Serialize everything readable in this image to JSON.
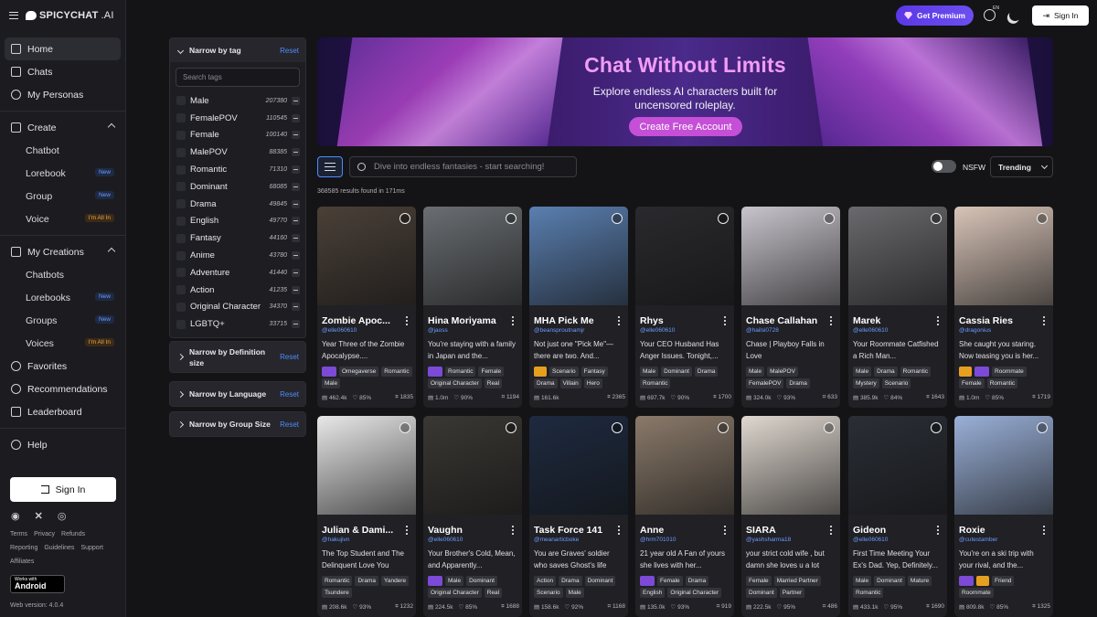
{
  "brand": {
    "name": "SPICYCHAT",
    "suffix": ".AI"
  },
  "sidebar": {
    "main": [
      {
        "label": "Home",
        "icon": "home-icon",
        "active": true
      },
      {
        "label": "Chats",
        "icon": "chat-icon"
      },
      {
        "label": "My Personas",
        "icon": "mask-icon"
      }
    ],
    "create": {
      "label": "Create",
      "icon": "plus-square-icon",
      "items": [
        {
          "label": "Chatbot",
          "badge": ""
        },
        {
          "label": "Lorebook",
          "badge": "New"
        },
        {
          "label": "Group",
          "badge": "New"
        },
        {
          "label": "Voice",
          "badge": "I'm All In"
        }
      ]
    },
    "creations": {
      "label": "My Creations",
      "icon": "folder-icon",
      "items": [
        {
          "label": "Chatbots",
          "badge": ""
        },
        {
          "label": "Lorebooks",
          "badge": "New"
        },
        {
          "label": "Groups",
          "badge": "New"
        },
        {
          "label": "Voices",
          "badge": "I'm All In"
        }
      ]
    },
    "extra": [
      {
        "label": "Favorites",
        "icon": "heart-icon"
      },
      {
        "label": "Recommendations",
        "icon": "compass-icon"
      },
      {
        "label": "Leaderboard",
        "icon": "trophy-icon"
      }
    ],
    "help": "Help",
    "signin": "Sign In",
    "links1": [
      "Terms",
      "Privacy",
      "Refunds"
    ],
    "links2": [
      "Reporting",
      "Guidelines",
      "Support"
    ],
    "links3": [
      "Affiliates"
    ],
    "android_small": "Works with",
    "android": "Android",
    "version": "Web version: 4.0.4"
  },
  "topbar": {
    "premium": "Get Premium",
    "lang": "EN",
    "signin": "Sign In"
  },
  "filters": {
    "tag_title": "Narrow by tag",
    "reset": "Reset",
    "search_placeholder": "Search tags",
    "tags": [
      {
        "label": "Male",
        "count": "207380"
      },
      {
        "label": "FemalePOV",
        "count": "110545"
      },
      {
        "label": "Female",
        "count": "100140"
      },
      {
        "label": "MalePOV",
        "count": "88385"
      },
      {
        "label": "Romantic",
        "count": "71310"
      },
      {
        "label": "Dominant",
        "count": "68085"
      },
      {
        "label": "Drama",
        "count": "49845"
      },
      {
        "label": "English",
        "count": "49770"
      },
      {
        "label": "Fantasy",
        "count": "44160"
      },
      {
        "label": "Anime",
        "count": "43780"
      },
      {
        "label": "Adventure",
        "count": "41440"
      },
      {
        "label": "Action",
        "count": "41235"
      },
      {
        "label": "Original Character",
        "count": "34370"
      },
      {
        "label": "LGBTQ+",
        "count": "33715"
      }
    ],
    "definition_title": "Narrow by Definition size",
    "language_title": "Narrow by Language",
    "group_title": "Narrow by Group Size"
  },
  "banner": {
    "title": "Chat Without Limits",
    "subtitle": "Explore endless AI characters built for uncensored roleplay.",
    "cta": "Create Free Account"
  },
  "search": {
    "placeholder": "Dive into endless fantasies - start searching!",
    "results": "368585 results found in 171ms",
    "nsfw": "NSFW",
    "sort": "Trending"
  },
  "cards": [
    {
      "name": "Zombie Apoc...",
      "handle": "@elle060610",
      "desc": "Year Three of the Zombie Apocalypse....",
      "tags": [
        "#purple",
        "Omegaverse",
        "Romantic",
        "Male"
      ],
      "chats": "462.4k",
      "rating": "85%",
      "count": "1835",
      "bg": "#4a4038"
    },
    {
      "name": "Hina Moriyama",
      "handle": "@jaoss",
      "desc": "You're staying with a family in Japan and the...",
      "tags": [
        "#purple",
        "Romantic",
        "Female",
        "Original Character",
        "Real"
      ],
      "chats": "1.0m",
      "rating": "90%",
      "count": "1194",
      "bg": "#6a6e72"
    },
    {
      "name": "MHA Pick Me",
      "handle": "@beansproutnamjr",
      "desc": "Not just one \"Pick Me\"— there are two. And...",
      "tags": [
        "#yellow",
        "Scenario",
        "Fantasy",
        "Drama",
        "Villain",
        "Hero"
      ],
      "chats": "161.6k",
      "rating": "",
      "count": "2365",
      "bg": "#5a7fb0"
    },
    {
      "name": "Rhys",
      "handle": "@elle060610",
      "desc": "Your CEO Husband Has Anger Issues. Tonight,...",
      "tags": [
        "Male",
        "Dominant",
        "Drama",
        "Romantic"
      ],
      "chats": "697.7k",
      "rating": "90%",
      "count": "1700",
      "bg": "#2a2a2e"
    },
    {
      "name": "Chase Callahan",
      "handle": "@hailsi0728",
      "desc": "Chase | Playboy Falls in Love",
      "tags": [
        "Male",
        "MalePOV",
        "FemalePOV",
        "Drama"
      ],
      "chats": "324.0k",
      "rating": "93%",
      "count": "633",
      "bg": "#c8c4cc"
    },
    {
      "name": "Marek",
      "handle": "@elle060610",
      "desc": "Your Roommate Catfished a Rich Man...",
      "tags": [
        "Male",
        "Drama",
        "Romantic",
        "Mystery",
        "Scenario"
      ],
      "chats": "385.9k",
      "rating": "84%",
      "count": "1643",
      "bg": "#6a6a6e"
    },
    {
      "name": "Cassia Ries",
      "handle": "@dragonius",
      "desc": "She caught you staring. Now teasing you is her...",
      "tags": [
        "#yellow",
        "#purple",
        "Roommate",
        "Female",
        "Romantic"
      ],
      "chats": "1.0m",
      "rating": "85%",
      "count": "1719",
      "bg": "#d8c4b8"
    },
    {
      "name": "Julian & Dami...",
      "handle": "@hakujivn",
      "desc": "The Top Student and The Delinquent Love You",
      "tags": [
        "Romantic",
        "Drama",
        "Yandere",
        "Tsundere"
      ],
      "chats": "208.6k",
      "rating": "93%",
      "count": "1232",
      "bg": "#e8e8e8"
    },
    {
      "name": "Vaughn",
      "handle": "@elle060610",
      "desc": "Your Brother's Cold, Mean, and Apparently...",
      "tags": [
        "#purple",
        "Male",
        "Dominant",
        "Original Character",
        "Real"
      ],
      "chats": "224.5k",
      "rating": "85%",
      "count": "1688",
      "bg": "#3a3834"
    },
    {
      "name": "Task Force 141",
      "handle": "@meanarticboke",
      "desc": "You are Graves' soldier who saves Ghost's life",
      "tags": [
        "Action",
        "Drama",
        "Dominant",
        "Scenario",
        "Male"
      ],
      "chats": "158.6k",
      "rating": "92%",
      "count": "1168",
      "bg": "#1e2a40"
    },
    {
      "name": "Anne",
      "handle": "@hrm701010",
      "desc": "21 year old A Fan of yours she lives with her...",
      "tags": [
        "#purple",
        "Female",
        "Drama",
        "English",
        "Original Character"
      ],
      "chats": "135.0k",
      "rating": "93%",
      "count": "919",
      "bg": "#8a7a6a"
    },
    {
      "name": "SIARA",
      "handle": "@yashsharma18",
      "desc": "your strict cold wife , but damn she loves u a lot",
      "tags": [
        "Female",
        "Married Partner",
        "Dominant",
        "Partner"
      ],
      "chats": "222.5k",
      "rating": "95%",
      "count": "486",
      "bg": "#e0d8d0"
    },
    {
      "name": "Gideon",
      "handle": "@elle060610",
      "desc": "First Time Meeting Your Ex's Dad. Yep, Definitely...",
      "tags": [
        "Male",
        "Dominant",
        "Mature",
        "Romantic"
      ],
      "chats": "433.1k",
      "rating": "95%",
      "count": "1690",
      "bg": "#2a2e36"
    },
    {
      "name": "Roxie",
      "handle": "@cutestamber",
      "desc": "You're on a ski trip with your rival, and the...",
      "tags": [
        "#purple",
        "#yellow",
        "Friend",
        "Roommate"
      ],
      "chats": "809.8k",
      "rating": "85%",
      "count": "1325",
      "bg": "#9ab0d8"
    }
  ]
}
